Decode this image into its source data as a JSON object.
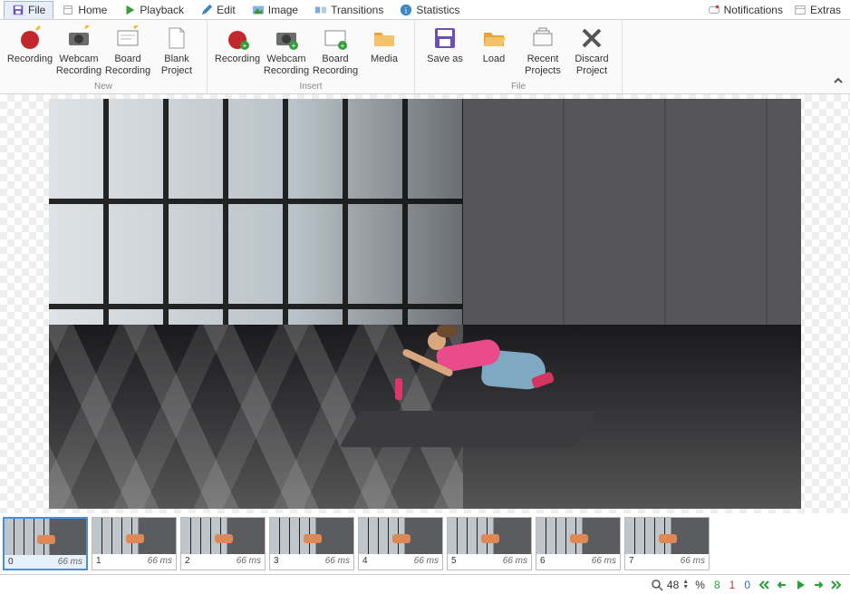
{
  "menu": {
    "tabs": [
      {
        "label": "File",
        "icon": "save"
      },
      {
        "label": "Home",
        "icon": "home"
      },
      {
        "label": "Playback",
        "icon": "play"
      },
      {
        "label": "Edit",
        "icon": "pencil"
      },
      {
        "label": "Image",
        "icon": "picture"
      },
      {
        "label": "Transitions",
        "icon": "transition"
      },
      {
        "label": "Statistics",
        "icon": "info"
      }
    ],
    "active": 0,
    "right": [
      {
        "label": "Notifications",
        "icon": "bell"
      },
      {
        "label": "Extras",
        "icon": "extras"
      }
    ]
  },
  "ribbon": {
    "groups": [
      {
        "label": "New",
        "buttons": [
          {
            "label": "Recording",
            "icon": "record"
          },
          {
            "label": "Webcam Recording",
            "icon": "webcam"
          },
          {
            "label": "Board Recording",
            "icon": "board"
          },
          {
            "label": "Blank Project",
            "icon": "blank"
          }
        ]
      },
      {
        "label": "Insert",
        "buttons": [
          {
            "label": "Recording",
            "icon": "record"
          },
          {
            "label": "Webcam Recording",
            "icon": "webcam"
          },
          {
            "label": "Board Recording",
            "icon": "board"
          },
          {
            "label": "Media",
            "icon": "folder"
          }
        ]
      },
      {
        "label": "File",
        "buttons": [
          {
            "label": "Save as",
            "icon": "saveas"
          },
          {
            "label": "Load",
            "icon": "folder"
          },
          {
            "label": "Recent Projects",
            "icon": "recent"
          },
          {
            "label": "Discard Project",
            "icon": "discard"
          }
        ]
      }
    ]
  },
  "frames": [
    {
      "index": "0",
      "duration": "66 ms",
      "selected": true
    },
    {
      "index": "1",
      "duration": "66 ms",
      "selected": false
    },
    {
      "index": "2",
      "duration": "66 ms",
      "selected": false
    },
    {
      "index": "3",
      "duration": "66 ms",
      "selected": false
    },
    {
      "index": "4",
      "duration": "66 ms",
      "selected": false
    },
    {
      "index": "5",
      "duration": "66 ms",
      "selected": false
    },
    {
      "index": "6",
      "duration": "66 ms",
      "selected": false
    },
    {
      "index": "7",
      "duration": "66 ms",
      "selected": false
    }
  ],
  "statusbar": {
    "zoom_value": "48",
    "zoom_unit": "%",
    "count_a": "8",
    "count_b": "1",
    "count_c": "0"
  }
}
